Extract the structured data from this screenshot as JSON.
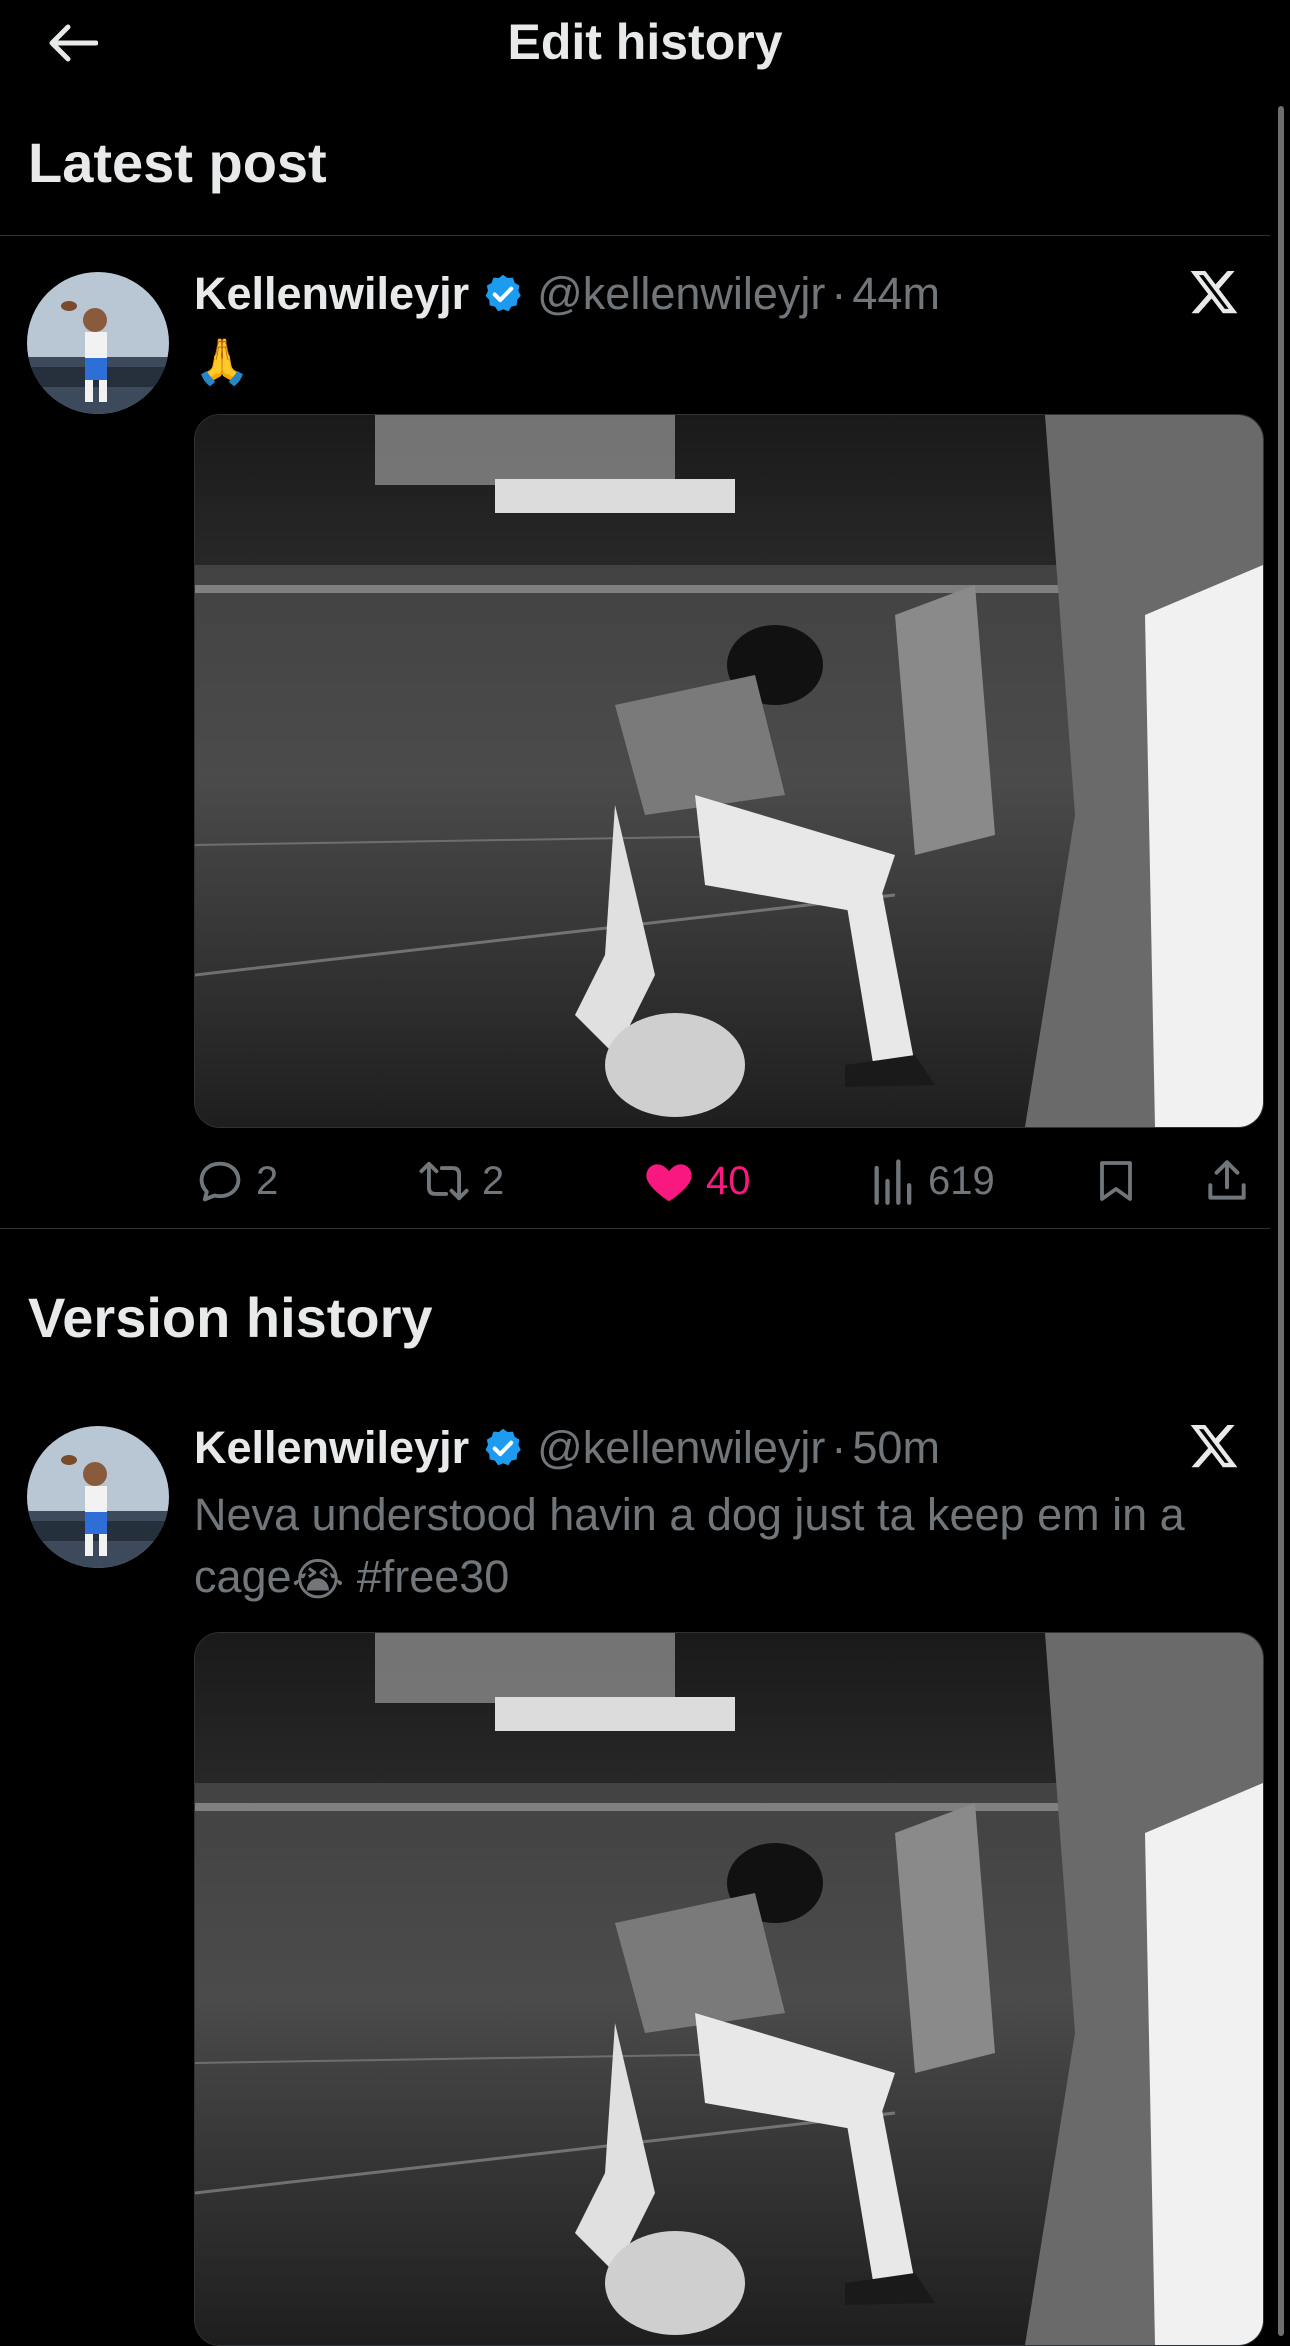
{
  "header": {
    "title": "Edit history",
    "back_icon": "arrow-left-icon"
  },
  "latest": {
    "section_title": "Latest post",
    "post": {
      "display_name": "Kellenwileyjr",
      "handle": "@kellenwileyjr",
      "separator": "·",
      "time": "44m",
      "text_emoji": "🙏",
      "image_alt": "Football player kneeling on field in stadium",
      "stats": {
        "replies": "2",
        "reposts": "2",
        "likes": "40",
        "views": "619"
      }
    }
  },
  "history": {
    "section_title": "Version history",
    "post": {
      "display_name": "Kellenwileyjr",
      "handle": "@kellenwileyjr",
      "separator": "·",
      "time": "50m",
      "text": "Neva understood havin a dog just ta keep em in a cage",
      "text_emoji": "😭",
      "hashtag": "#free30",
      "image_alt": "Football player kneeling on field in stadium"
    }
  },
  "colors": {
    "background": "#000000",
    "text_primary": "#e7e9ea",
    "text_secondary": "#71767b",
    "verified_blue": "#1d9bf0",
    "like_pink": "#f91880",
    "divider": "#2f3336"
  }
}
